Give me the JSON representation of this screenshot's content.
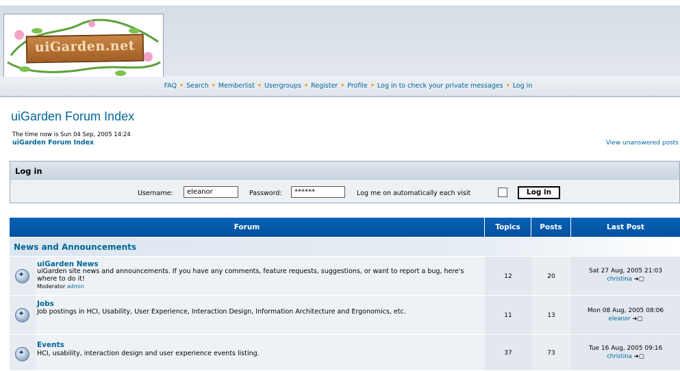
{
  "logo": {
    "text": "uiGarden.net"
  },
  "nav": {
    "items": [
      "FAQ",
      "Search",
      "Memberlist",
      "Usergroups",
      "Register",
      "Profile",
      "Log in to check your private messages",
      "Log in"
    ]
  },
  "page": {
    "title": "uiGarden Forum Index",
    "time_text": "The time now is Sun 04 Sep, 2005 14:24",
    "index_link": "uiGarden Forum Index",
    "unanswered_link": "View unanswered posts"
  },
  "login": {
    "title": "Log in",
    "username_label": "Username:",
    "username_value": "eleanor",
    "password_label": "Password:",
    "password_value": "******",
    "auto_label": "Log me on automatically each visit",
    "button_label": "Log in"
  },
  "table": {
    "headers": {
      "forum": "Forum",
      "topics": "Topics",
      "posts": "Posts",
      "last_post": "Last Post"
    },
    "category": "News and Announcements",
    "forums": [
      {
        "name": "uiGarden News",
        "description": "uiGarden site news and announcements. If you have any comments, feature requests, suggestions, or want to report a bug, here's where to do it!",
        "moderator_label": "Moderator",
        "moderator": "admin",
        "topics": "12",
        "posts": "20",
        "last_post_date": "Sat 27 Aug, 2005 21:03",
        "last_post_user": "christina"
      },
      {
        "name": "Jobs",
        "description": "Job postings in HCI, Usability, User Experience, Interaction Design, Information Architecture and Ergonomics, etc.",
        "topics": "11",
        "posts": "13",
        "last_post_date": "Mon 08 Aug, 2005 08:06",
        "last_post_user": "eleanor"
      },
      {
        "name": "Events",
        "description": "HCI, usability, interaction design and user experience events listing.",
        "topics": "37",
        "posts": "73",
        "last_post_date": "Tue 16 Aug, 2005 09:16",
        "last_post_user": "christina"
      }
    ]
  },
  "icons": {
    "forum_icon": "forum-folder-icon",
    "last_post_icon": "view-latest-post-icon"
  },
  "colors": {
    "link": "#006699",
    "header_blue": "#0050a0",
    "nav_separator": "#f0a000"
  }
}
